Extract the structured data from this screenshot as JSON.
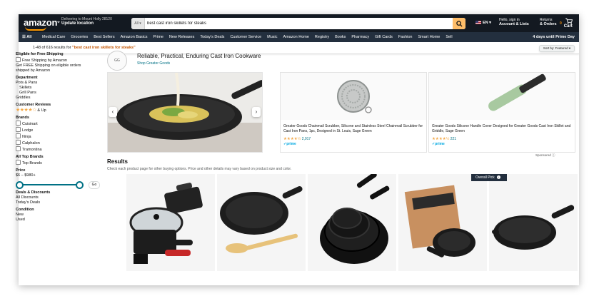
{
  "header": {
    "logo": "amazon",
    "deliver_line1": "Delivering to Mount Holly 28120",
    "deliver_line2": "Update location",
    "search_category": "All",
    "search_value": "best cast iron skillets for steaks",
    "language": "EN",
    "account_line1": "Hello, sign in",
    "account_line2": "Account & Lists",
    "returns_line1": "Returns",
    "returns_line2": "& Orders",
    "cart_count": "0",
    "cart_label": "Cart"
  },
  "nav": {
    "all_label": "All",
    "items": [
      "Medical Care",
      "Groceries",
      "Best Sellers",
      "Amazon Basics",
      "Prime",
      "New Releases",
      "Today's Deals",
      "Customer Service",
      "Music",
      "Amazon Home",
      "Registry",
      "Books",
      "Pharmacy",
      "Gift Cards",
      "Fashion",
      "Smart Home",
      "Sell"
    ],
    "prime_promo": "4 days until Prime Day"
  },
  "results_bar": {
    "count_text": "1-48 of 616 results for",
    "query": "\"best cast iron skillets for steaks\"",
    "sort_label": "Sort by: Featured"
  },
  "sidebar": {
    "free_ship_heading": "Eligible for Free Shipping",
    "free_ship_option": "Free Shipping by Amazon",
    "free_ship_note": "Get FREE Shipping on eligible orders shipped by Amazon",
    "department_heading": "Department",
    "departments": [
      "Pots & Pans",
      "Skillets",
      "Grill Pans",
      "Griddles"
    ],
    "reviews_heading": "Customer Reviews",
    "reviews_stars": "★★★★☆",
    "reviews_suffix": "& Up",
    "brands_heading": "Brands",
    "brands": [
      "Cuisinart",
      "Lodge",
      "Ninja",
      "Calphalon",
      "Tramontina"
    ],
    "top_brands_heading": "All Top Brands",
    "top_brands_option": "Top Brands",
    "price_heading": "Price",
    "price_range": "$6 – $980+",
    "price_go": "Go",
    "deals_heading": "Deals & Discounts",
    "deals": [
      "All Discounts",
      "Today's Deals"
    ],
    "condition_heading": "Condition",
    "conditions": [
      "New",
      "Used"
    ]
  },
  "sponsored": {
    "brand_title": "Reliable, Practical, Enduring Cast Iron Cookware",
    "brand_link": "Shop Greater Goods",
    "brand_logo_text": "GG",
    "products": [
      {
        "title": "Greater Goods Chainmail Scrubber, Silicone and Stainless Steel Chainmail Scrubber for Cast Iron Pans, 1pc, Designed in St. Louis, Sage Green",
        "stars": "★★★★½",
        "reviews": "2,017",
        "prime": "✓prime"
      },
      {
        "title": "Greater Goods Silicone Handle Cover Designed for Greater Goods Cast Iron Skillet and Griddle, Sage Green",
        "stars": "★★★★½",
        "reviews": "221",
        "prime": "✓prime"
      }
    ],
    "label": "Sponsored"
  },
  "results": {
    "heading": "Results",
    "subtext": "Check each product page for other buying options. Price and other details may vary based on product size and color.",
    "badge": "Overall Pick"
  },
  "colors": {
    "header_bg": "#131921",
    "nav_bg": "#232f3e",
    "search_button": "#febd69",
    "link": "#007185",
    "query": "#c45500",
    "star": "#f3a847"
  }
}
